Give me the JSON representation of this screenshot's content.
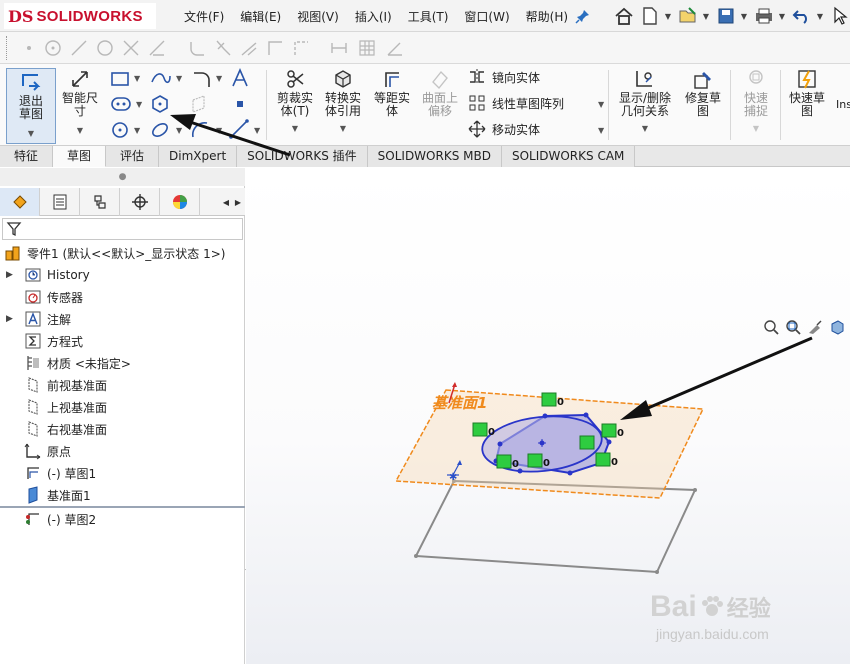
{
  "app": {
    "logo_mark": "DS",
    "logo_text": "SOLIDWORKS"
  },
  "menu": [
    "文件(F)",
    "编辑(E)",
    "视图(V)",
    "插入(I)",
    "工具(T)",
    "窗口(W)",
    "帮助(H)"
  ],
  "quick_access_icons": [
    "home-icon",
    "new-document-icon",
    "open-icon",
    "save-icon",
    "print-icon",
    "undo-icon",
    "select-icon"
  ],
  "sketch_tools": {
    "exit_sketch": "退出草图",
    "smart_dimension": "智能尺寸",
    "trim_entities": "剪裁实体(T)",
    "convert_entities": "转换实体引用",
    "offset_entities": "等距实体",
    "offset_on_surface": "曲面上偏移",
    "mirror_entities": "镜向实体",
    "linear_pattern": "线性草图阵列",
    "move_entities": "移动实体",
    "display_delete_relations": "显示/删除几何关系",
    "repair_sketch": "修复草图",
    "quick_snaps": "快速捕捉",
    "rapid_sketch": "快速草图",
    "overflow": "Ins"
  },
  "tabs": [
    "特征",
    "草图",
    "评估",
    "DimXpert",
    "SOLIDWORKS 插件",
    "SOLIDWORKS MBD",
    "SOLIDWORKS CAM"
  ],
  "active_tab": "草图",
  "tree": {
    "root": "零件1 (默认<<默认>_显示状态 1>)",
    "items": [
      {
        "label": "History",
        "expandable": true
      },
      {
        "label": "传感器",
        "expandable": false
      },
      {
        "label": "注解",
        "expandable": true
      },
      {
        "label": "方程式",
        "expandable": false
      },
      {
        "label": "材质 <未指定>",
        "expandable": false
      },
      {
        "label": "前视基准面",
        "expandable": false
      },
      {
        "label": "上视基准面",
        "expandable": false
      },
      {
        "label": "右视基准面",
        "expandable": false
      },
      {
        "label": "原点",
        "expandable": false
      },
      {
        "label": "(-) 草图1",
        "expandable": false
      },
      {
        "label": "基准面1",
        "expandable": false
      },
      {
        "label": "(-) 草图2",
        "expandable": false
      }
    ]
  },
  "viewport": {
    "plane_label": "基准面1",
    "relation_badge": "0",
    "colors": {
      "plane": "#f08a1c",
      "sketch": "#2a35c9",
      "fill": "#a9a8e0",
      "badge": "#2ecc40",
      "arrow": "#111111"
    }
  },
  "watermark": {
    "brand": "Bai",
    "brand_cn": "经验",
    "url": "jingyan.baidu.com"
  }
}
